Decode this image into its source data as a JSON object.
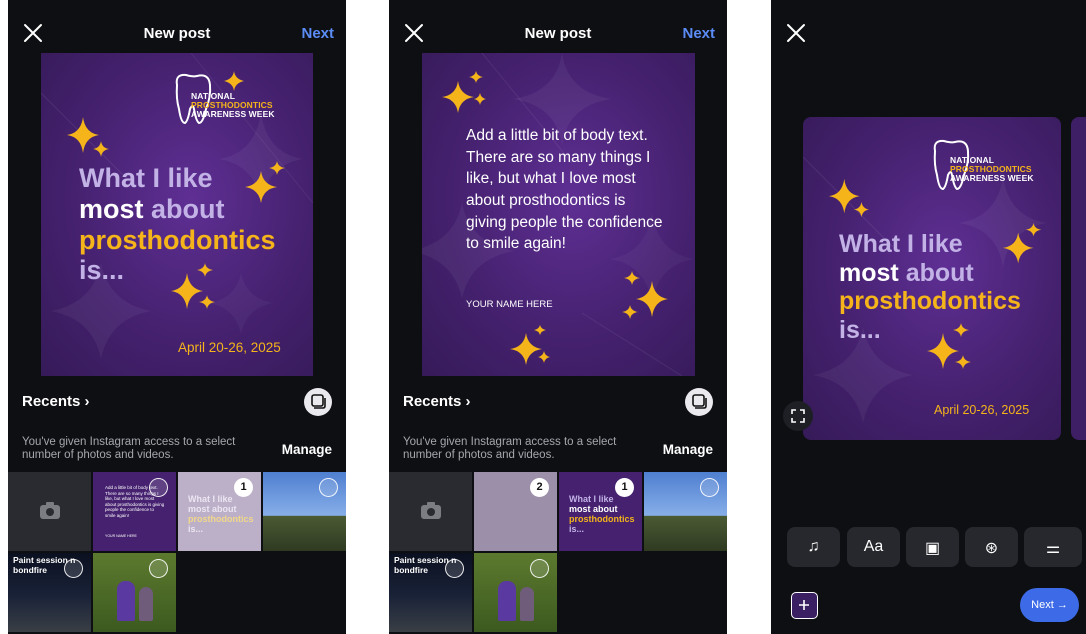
{
  "colors": {
    "accent": "#5b8cf5",
    "purple": "#45216f",
    "gold": "#f4b41a",
    "lavender": "#c2b2e6",
    "next_button": "#3d6be8"
  },
  "screen1": {
    "title": "New post",
    "next": "Next",
    "post": {
      "logo": [
        "NATIONAL",
        "PROSTHODONTICS",
        "AWARENESS WEEK"
      ],
      "headline": [
        "What I like",
        "most",
        "about",
        "prosthodontics",
        "is..."
      ],
      "date": "April 20-26, 2025"
    },
    "recents": "Recents",
    "access_text": "You've given Instagram access to a select number of photos and videos.",
    "manage": "Manage",
    "grid": {
      "badge_selected": "1",
      "paint_caption": "Paint session n bondfire",
      "thumb_text": "Add a little bit of body text. There are so many things I like, but what I love most about prosthodontics is giving people the confidence to smile again!",
      "thumb_name": "YOUR NAME HERE",
      "thumb_headline": [
        "What I like",
        "most about",
        "prosthodontics",
        "is..."
      ]
    }
  },
  "screen2": {
    "title": "New post",
    "next": "Next",
    "post": {
      "body": "Add a little bit of body text. There are so many things I like, but what I love most about prosthodontics is giving people the confidence to smile again!",
      "name": "YOUR NAME HERE"
    },
    "recents": "Recents",
    "access_text": "You've given Instagram access to a select number of photos and videos.",
    "manage": "Manage",
    "grid": {
      "badge_a": "2",
      "badge_b": "1",
      "paint_caption": "Paint session n bondfire",
      "thumb_headline": [
        "What I like",
        "most about",
        "prosthodontics",
        "is..."
      ]
    }
  },
  "screen3": {
    "post": {
      "logo": [
        "NATIONAL",
        "PROSTHODONTICS",
        "AWARENESS WEEK"
      ],
      "headline": [
        "What I like",
        "most",
        "about",
        "prosthodontics",
        "is..."
      ],
      "date": "April 20-26, 2025"
    },
    "tools": [
      {
        "icon": "music-icon",
        "glyph": "♫"
      },
      {
        "icon": "text-icon",
        "glyph": "Aa"
      },
      {
        "icon": "sticker-icon",
        "glyph": "▣"
      },
      {
        "icon": "filter-icon",
        "glyph": "⊛"
      },
      {
        "icon": "adjust-icon",
        "glyph": "⚌"
      }
    ],
    "next_button": "Next →"
  }
}
